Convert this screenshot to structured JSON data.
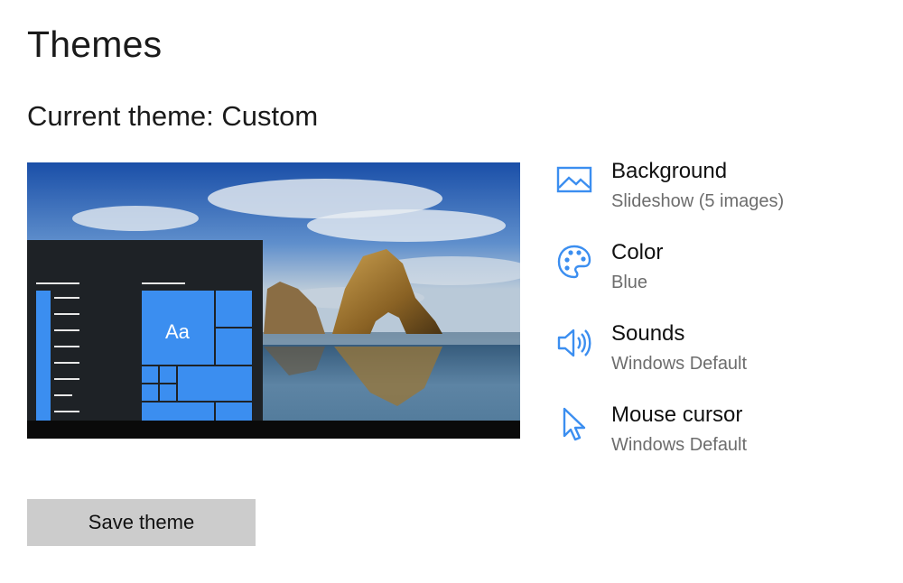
{
  "page": {
    "title": "Themes",
    "current_theme": "Current theme: Custom"
  },
  "preview": {
    "tile_text": "Aa",
    "accent": "#3b8ef0"
  },
  "settings": [
    {
      "name": "Background",
      "value": "Slideshow (5 images)",
      "icon": "picture-icon"
    },
    {
      "name": "Color",
      "value": "Blue",
      "icon": "palette-icon"
    },
    {
      "name": "Sounds",
      "value": "Windows Default",
      "icon": "speaker-icon"
    },
    {
      "name": "Mouse cursor",
      "value": "Windows Default",
      "icon": "cursor-icon"
    }
  ],
  "actions": {
    "save_label": "Save theme"
  },
  "colors": {
    "accent": "#3b8ef0",
    "button_bg": "#cccccc",
    "secondary_text": "#6d6d6d"
  }
}
